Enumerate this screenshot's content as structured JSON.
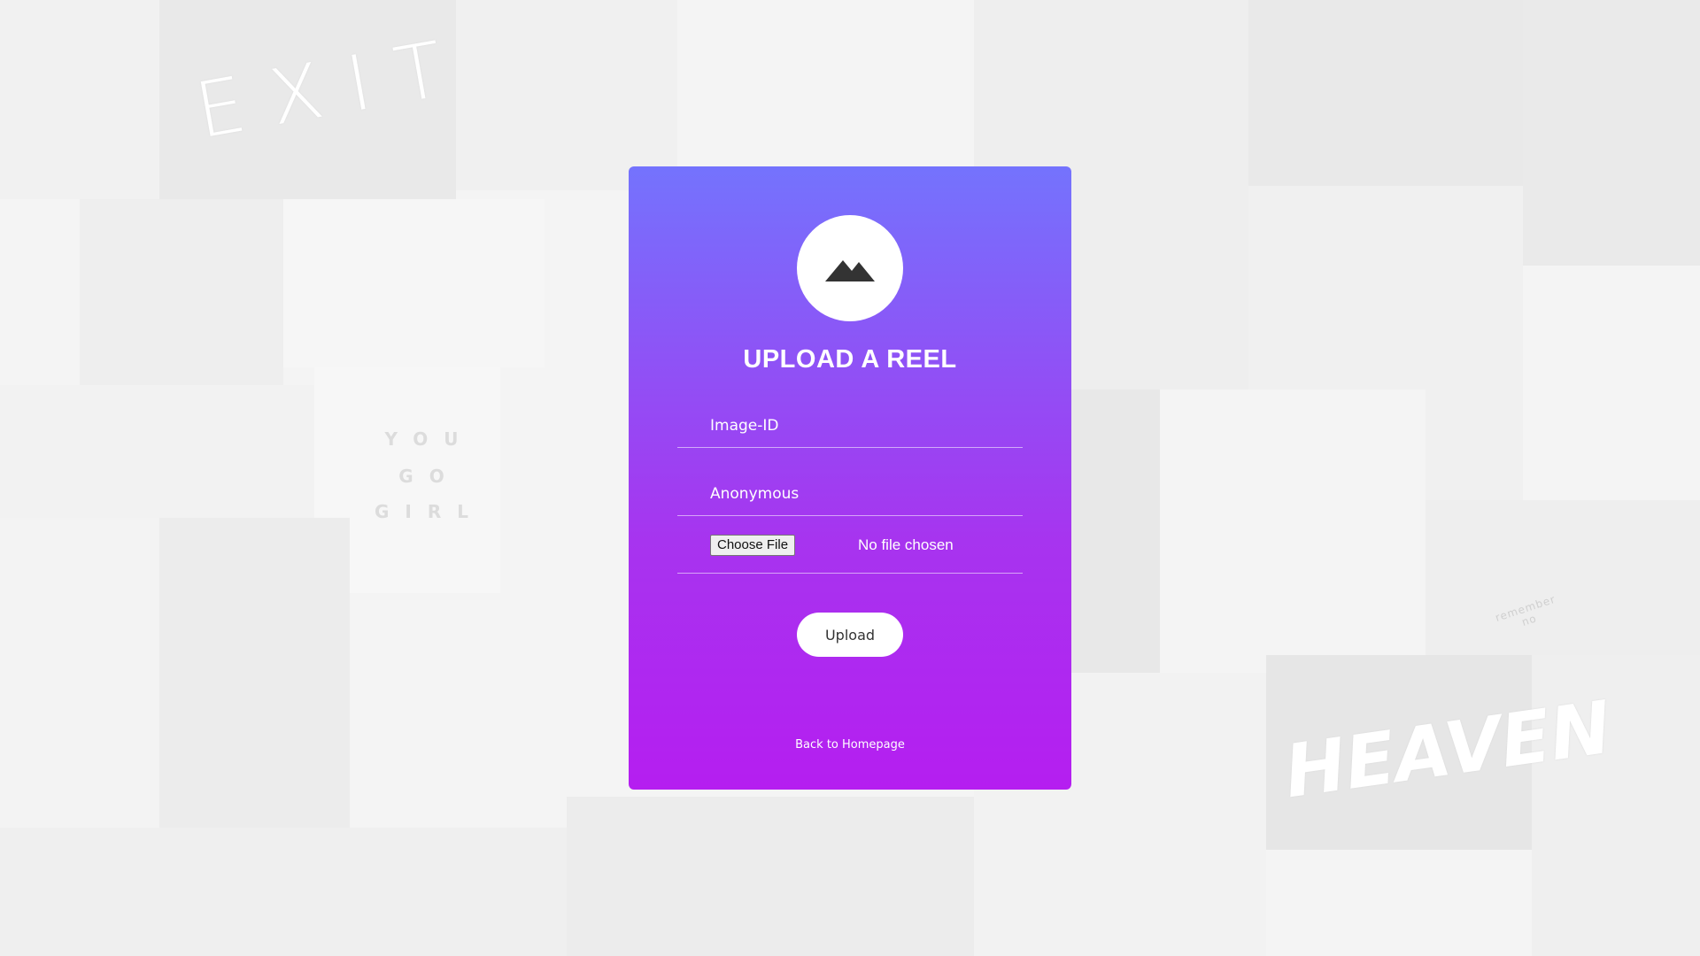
{
  "background": {
    "exit_sign": "EXIT",
    "letter_board": [
      "YOU",
      "GO",
      "GIRL"
    ],
    "neon_sign": "HEAVEN",
    "note_text": "remember\nno"
  },
  "card": {
    "icon": "mountain-icon",
    "title": "UPLOAD A REEL",
    "fields": {
      "image_id_placeholder": "Image-ID",
      "name_placeholder": "Anonymous"
    },
    "file_input": {
      "button_label": "Choose File",
      "status": "No file chosen"
    },
    "upload_label": "Upload",
    "back_link": "Back to Homepage"
  },
  "colors": {
    "gradient_top": "#7473fd",
    "gradient_bottom": "#b51ef0",
    "icon_dark": "#333333"
  }
}
